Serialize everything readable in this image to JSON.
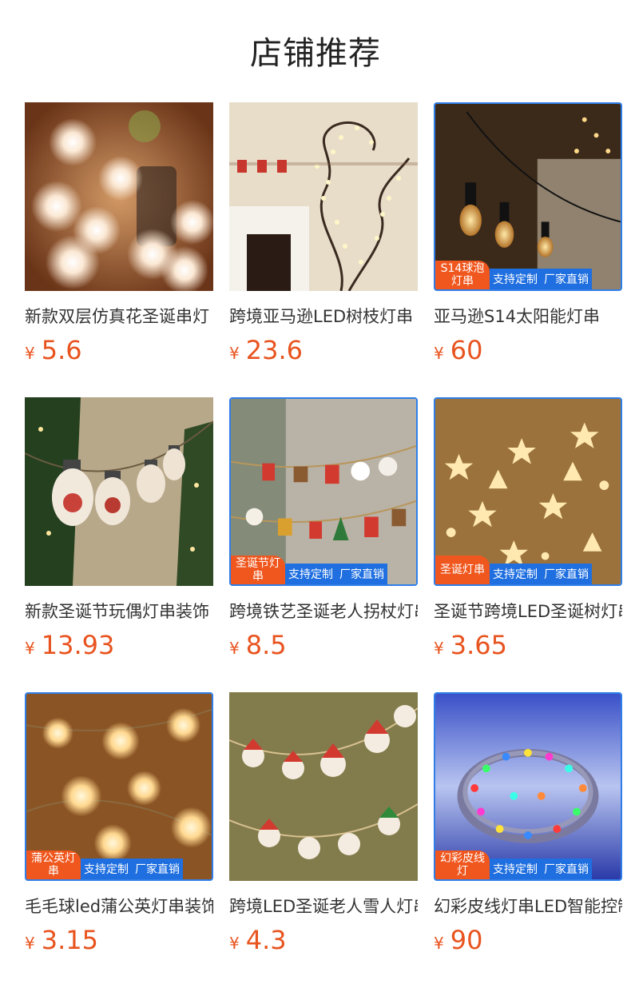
{
  "section_title": "店铺推荐",
  "colors": {
    "price": "#e8541f",
    "badge_orange": "#f0571e",
    "badge_blue": "#1f6fe0",
    "frame": "#2f7ee8"
  },
  "products": [
    {
      "name": "新款双层仿真花圣诞串灯",
      "currency": "¥",
      "price": "5.6",
      "category_badge": "",
      "features": []
    },
    {
      "name": "跨境亚马逊LED树枝灯串",
      "currency": "¥",
      "price": "23.6",
      "category_badge": "",
      "features": []
    },
    {
      "name": "亚马逊S14太阳能灯串",
      "currency": "¥",
      "price": "60",
      "category_badge": "S14球泡灯串",
      "features": [
        "支持定制",
        "厂家直销"
      ]
    },
    {
      "name": "新款圣诞节玩偶灯串装饰",
      "currency": "¥",
      "price": "13.93",
      "category_badge": "",
      "features": []
    },
    {
      "name": "跨境铁艺圣诞老人拐杖灯串",
      "currency": "¥",
      "price": "8.5",
      "category_badge": "圣诞节灯串",
      "features": [
        "支持定制",
        "厂家直销"
      ]
    },
    {
      "name": "圣诞节跨境LED圣诞树灯串",
      "currency": "¥",
      "price": "3.65",
      "category_badge": "圣诞灯串",
      "features": [
        "支持定制",
        "厂家直销"
      ]
    },
    {
      "name": "毛毛球led蒲公英灯串装饰",
      "currency": "¥",
      "price": "3.15",
      "category_badge": "蒲公英灯串",
      "features": [
        "支持定制",
        "厂家直销"
      ]
    },
    {
      "name": "跨境LED圣诞老人雪人灯串",
      "currency": "¥",
      "price": "4.3",
      "category_badge": "",
      "features": []
    },
    {
      "name": "幻彩皮线灯串LED智能控制",
      "currency": "¥",
      "price": "90",
      "category_badge": "幻彩皮线灯",
      "features": [
        "支持定制",
        "厂家直销"
      ]
    }
  ]
}
